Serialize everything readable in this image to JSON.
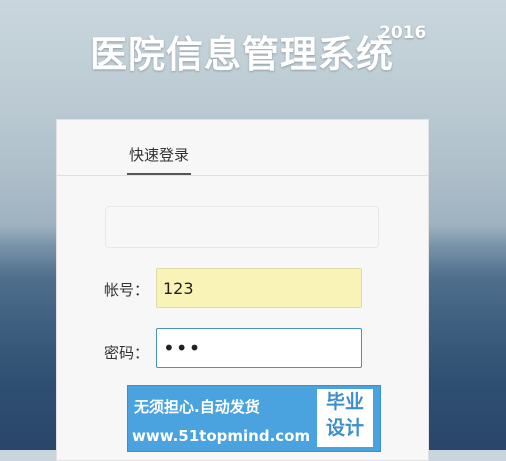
{
  "header": {
    "title": "医院信息管理系统",
    "year": "2016"
  },
  "login": {
    "tab_label": "快速登录",
    "message": "",
    "account_label": "帐号：",
    "account_value": "123",
    "password_label": "密码：",
    "password_value": "•••"
  },
  "ad": {
    "line1": "无须担心.自动发货",
    "line2": "www.51topmind.com",
    "badge_line1": "毕业",
    "badge_line2": "设计"
  }
}
